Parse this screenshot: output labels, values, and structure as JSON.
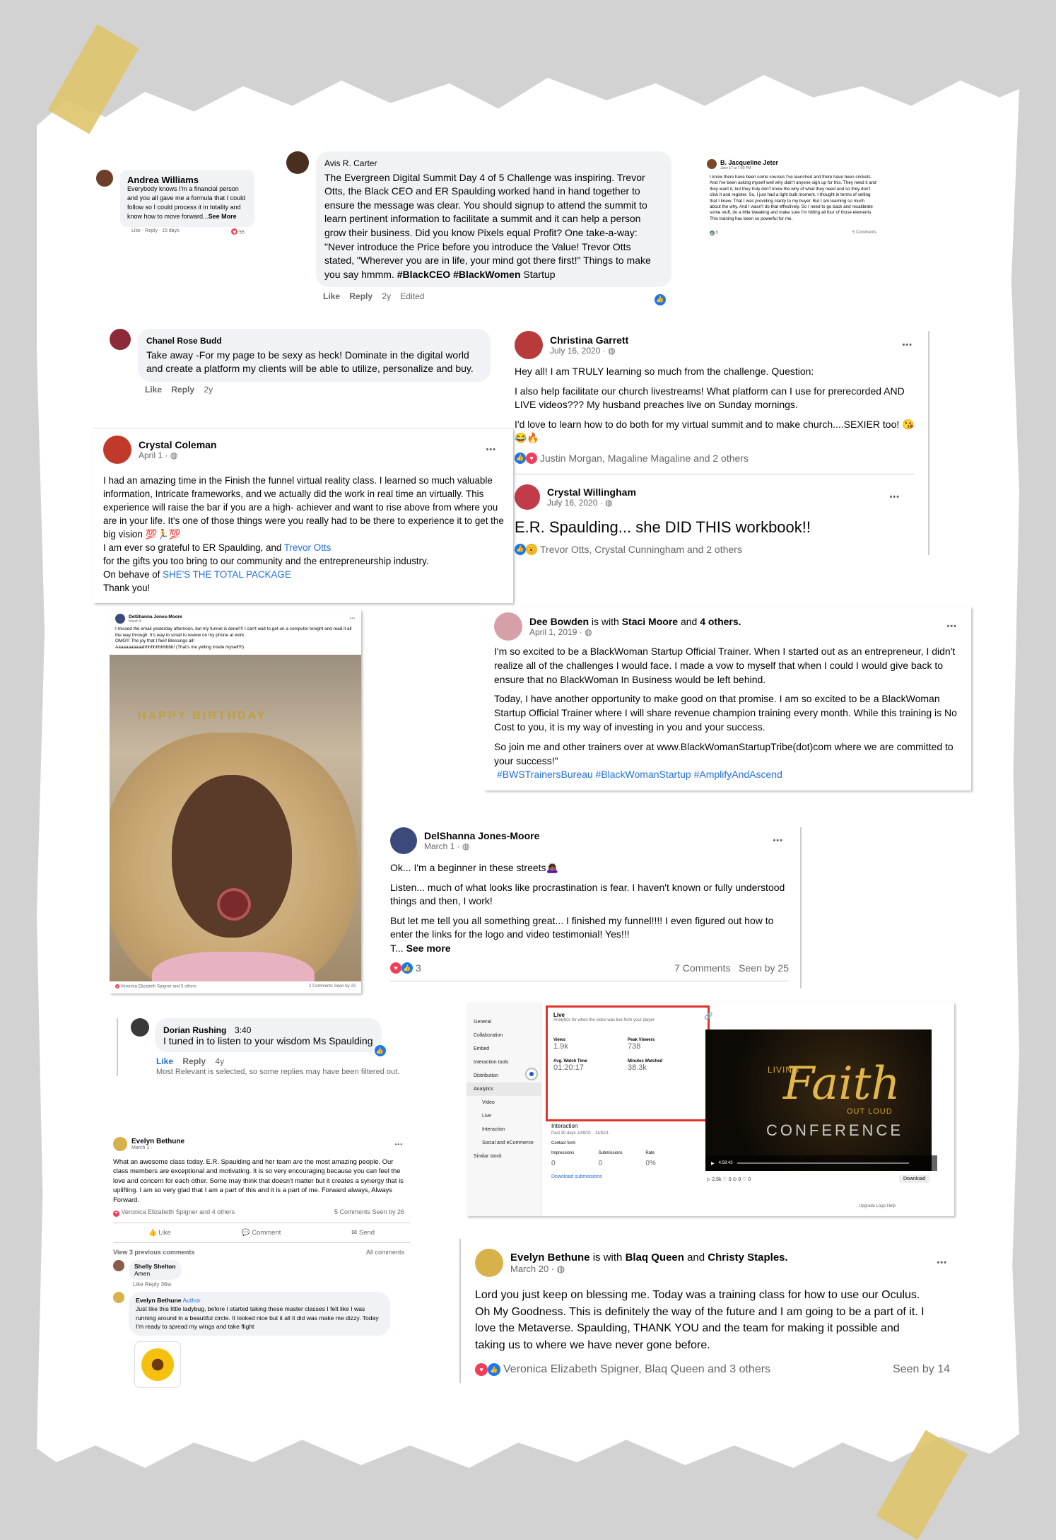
{
  "andrea": {
    "name": "Andrea Williams",
    "text": "Everybody knows I'm a financial person and you all gave me a formula that I could follow so I could process it in totality and know how to move forward...",
    "see_more": "See More",
    "actions": "Like · Reply · 15 days",
    "count": "55"
  },
  "avis": {
    "name": "Avis R. Carter",
    "text": "The Evergreen Digital Summit Day 4 of 5 Challenge was inspiring. Trevor Otts, the Black CEO and ER Spaulding worked hand in hand together to ensure the message was clear. You should signup to attend the summit to learn pertinent information to facilitate a summit and it can help a person grow their business. Did you know Pixels equal Profit? One take-a-way: \"Never introduce the Price before you introduce the Value! Trevor Otts stated, \"Wherever you are in life, your mind got there first!\" Things to make you say hmmm.",
    "tags": "#BlackCEO #BlackWomen",
    "startup": "Startup",
    "like": "Like",
    "reply": "Reply",
    "age": "2y",
    "edited": "Edited"
  },
  "jacqueline": {
    "name": "B. Jacqueline Jeter",
    "time": "June 17 at 7:00 PM",
    "text": "I know there have been some courses I've launched and there have been crickets. And I've been asking myself well why didn't anyone sign up for this. They need it and they want it, but they truly don't know the why of what they need and so they don't click it and register. So, I just had a light bulb moment. I thought in terms of selling that I knew. That I was providing clarity to my buyer. But I am learning so much about the why. And I wasn't do that effectively. So I need to go back and recalibrate some stuff, do a little tweaking and make sure I'm hitting all four of those elements. This training has been so powerful for me.",
    "count": "5",
    "comments": "5 Comments"
  },
  "chanel": {
    "name": "Chanel Rose Budd",
    "text": "Take away -For my page to be sexy as heck! Dominate in the digital world and create a platform my clients will be able to utilize, personalize and buy.",
    "like": "Like",
    "reply": "Reply",
    "age": "2y"
  },
  "christina": {
    "name": "Christina Garrett",
    "date": "July 16, 2020 ·",
    "p1": "Hey all! I am TRULY learning so much from the challenge. Question:",
    "p2": "I also help facilitate our church livestreams! What platform can I use for prerecorded AND LIVE videos??? My husband preaches live on Sunday mornings.",
    "p3": "I'd love to learn how to do both for my virtual summit and to make church....SEXIER too! 😘😂🔥",
    "reactions": "Justin Morgan, Magaline Magaline and 2 others"
  },
  "willingham": {
    "name": "Crystal Willingham",
    "date": "July 16, 2020 ·",
    "text": "E.R. Spaulding... she DID THIS workbook!!",
    "reactions": "Trevor Otts, Crystal Cunningham and 2 others"
  },
  "crystal_c": {
    "name": "Crystal Coleman",
    "date": "April 1 ·",
    "p1": "I had an amazing time in the Finish the funnel virtual reality class.  I learned so much valuable information, Intricate frameworks, and we actually did the work in real time an virtually.  This experience will raise the bar if you are a high- achiever and want to rise above from where you are in your life.  It's one of those things were you really had to be there to experience it to get the big vision 💯🏃💯",
    "p2a": "I am ever so grateful to ER Spaulding, and ",
    "p2link": "Trevor Otts",
    "p3": "for the gifts you too bring to our community and the entrepreneurship industry.",
    "p4a": "On behave of ",
    "p4link": "SHE'S THE TOTAL PACKAGE",
    "p5": "Thank you!"
  },
  "delshanna_small": {
    "name": "DelShanna Jones-Moore",
    "date": "March 8 ·",
    "text": "I missed the email yesterday afternoon, but my funnel is done!!!! I can't wait to get on a computer tonight and read it all the way through. It's way to small to review on my phone at work.",
    "omg": "OMG!!! The joy that I feel! Blessings all!",
    "yell": "Aaaaaaaaaaahhhhhhhhhbbb! (That's me yelling inside myself!!!)",
    "reactions": "Veronica Elizabeth Spigner and 5 others",
    "comments": "2 Comments  Seen by 23",
    "banner": "HAPPY BIRTHDAY"
  },
  "dee": {
    "name": "Dee Bowden",
    "is_with": "is with",
    "with1": "Staci Moore",
    "and": "and",
    "with2": "4 others.",
    "date": "April 1, 2019 ·",
    "p1": "I'm so excited to be a BlackWoman Startup Official Trainer. When I started out as an entrepreneur, I didn't realize all of the challenges I would face. I made a vow to myself that when I could I would give back to ensure that no BlackWoman In Business would be left behind.",
    "p2": "Today, I have another opportunity to make good on that promise. I am so excited to be a BlackWoman Startup Official Trainer where I will share revenue champion training every month. While this training is No Cost to you, it is my way of investing in you and your success.",
    "p3": "So join me and other trainers over at www.BlackWomanStartupTribe(dot)com where we are committed to your success!\"",
    "tags": "#BWSTrainersBureau #BlackWomanStartup #AmplifyAndAscend"
  },
  "delshanna": {
    "name": "DelShanna Jones-Moore",
    "date": "March 1 ·",
    "p1": "Ok... I'm a beginner in these streets🙇🏾‍♀️",
    "p2": "Listen... much of what looks like procrastination is fear. I haven't known or fully understood things and then, I work!",
    "p3": "But let me tell you all something great... I finished my funnel!!!! I even figured out how to enter the links for the logo and video testimonial! Yes!!!",
    "p4": "T...",
    "see_more": "See more",
    "count": "3",
    "comments": "7 Comments",
    "seen": "Seen by 25"
  },
  "dorian": {
    "name": "Dorian Rushing",
    "time": "3:40",
    "text": "I tuned in to listen to your wisdom Ms Spaulding",
    "like": "Like",
    "reply": "Reply",
    "age": "4y",
    "note": "Most Relevant is selected, so some replies may have been filtered out."
  },
  "analytics": {
    "menu": [
      "General",
      "Collaboration",
      "Embed",
      "Interaction tools",
      "Distribution",
      "Analytics",
      "Video",
      "Live",
      "Interaction",
      "Social and eCommerce",
      "Similar stock"
    ],
    "live": "Live",
    "live_sub": "Analytics for when the video was live from your player",
    "views_label": "Views",
    "views": "1.9k",
    "peak_label": "Peak Viewers",
    "peak": "738",
    "watch_label": "Avg. Watch Time",
    "watch": "01:20:17",
    "minutes_label": "Minutes Watched",
    "minutes": "38.3k",
    "interaction": "Interaction",
    "range": "Past 30 days  10/9/21 - 11/8/21",
    "contact": "Contact form",
    "imp_label": "Impressions",
    "imp": "0",
    "sub_label": "Submissions",
    "sub": "0",
    "rate_label": "Rate",
    "rate": "0%",
    "download_subs": "Download submissions",
    "video_top": "LIVING",
    "video_main": "Faith",
    "video_sub": "OUT LOUD",
    "video_conf": "CONFERENCE",
    "time": "4:58:43",
    "stats": "▷ 2.5k  ♡ 0  ⊙ 0  ♡ 0",
    "download": "Download",
    "footer": "Upgrade  Logo  Help"
  },
  "evelyn1": {
    "name": "Evelyn Bethune",
    "date": "March 1 ·",
    "text": "What an awesome class today.  E.R. Spaulding and her team are the most amazing people.  Our class members are exceptional and motivating.  It is so very encouraging because you can feel the love and concern for each other.  Some may think that doesn't matter but it creates a synergy that is uplifting.  I am so very glad that I am a part of this and it is a part of me.  Forward always, Always Forward.",
    "reactions": "Veronica Elizabeth Spigner and 4 others",
    "comments": "5 Comments  Seen by 26",
    "like": "Like",
    "comment": "Comment",
    "send": "Send",
    "prev": "View 3 previous comments",
    "all": "All comments",
    "c1_name": "Shelly Shelton",
    "c1_text": "Amen",
    "c1_actions": "Like  Reply  36w",
    "c2_name": "Evelyn Bethune",
    "c2_badge": "Author",
    "c2_text": "Just like this little ladybug, before I started taking these master classes I felt like I was running around in a beautiful circle. It looked nice but it all it did was make me dizzy. Today I'm ready to spread my wings and take flight"
  },
  "evelyn2": {
    "name": "Evelyn Bethune",
    "is_with": "is with",
    "with1": "Blaq Queen",
    "and": "and",
    "with2": "Christy Staples.",
    "date": "March 20 ·",
    "text": "Lord you just keep on blessing me.  Today was a training class for how to use our Oculus.  Oh My Goodness.  This is definitely the way of the future and I am going to be a part of it.  I love the Metaverse.      Spaulding, THANK YOU and the team for making it possible and taking us to where we have never gone before.",
    "reactions": "Veronica Elizabeth Spigner, Blaq Queen and 3 others",
    "seen": "Seen by 14"
  },
  "icons": {
    "dots": "•••",
    "globe": "◍"
  },
  "colors": {
    "accent": "#216fdb",
    "like": "#1877f2",
    "heart": "#f33e58",
    "highlight": "#e0342a"
  }
}
